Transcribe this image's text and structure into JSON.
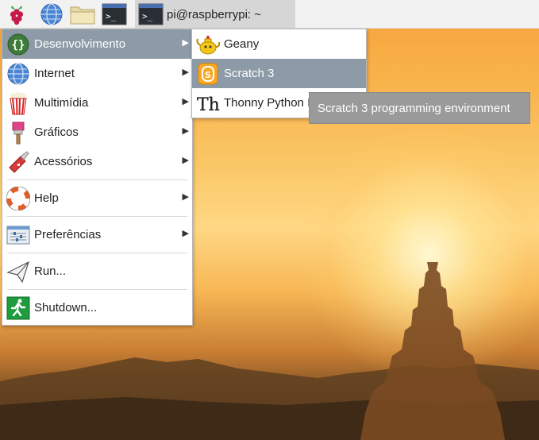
{
  "taskbar": {
    "raspberry_menu_icon": "raspberry-logo",
    "browser_icon": "globe",
    "files_icon": "folder",
    "terminal_icon": "terminal",
    "task": {
      "icon": "terminal",
      "label": "pi@raspberrypi: ~"
    }
  },
  "main_menu": {
    "items": [
      {
        "label": "Desenvolvimento",
        "icon": "code-braces",
        "has_submenu": true,
        "active": true
      },
      {
        "label": "Internet",
        "icon": "globe",
        "has_submenu": true
      },
      {
        "label": "Multimídia",
        "icon": "popcorn",
        "has_submenu": true
      },
      {
        "label": "Gráficos",
        "icon": "paintbrush",
        "has_submenu": true
      },
      {
        "label": "Acessórios",
        "icon": "swiss-knife",
        "has_submenu": true
      },
      {
        "label": "Help",
        "icon": "lifebuoy",
        "has_submenu": true
      },
      {
        "label": "Preferências",
        "icon": "settings-panel",
        "has_submenu": true
      },
      {
        "label": "Run...",
        "icon": "paper-plane",
        "has_submenu": false
      },
      {
        "label": "Shutdown...",
        "icon": "exit-running-man",
        "has_submenu": false
      }
    ]
  },
  "submenu": {
    "items": [
      {
        "label": "Geany",
        "icon": "geany-teapot"
      },
      {
        "label": "Scratch 3",
        "icon": "scratch",
        "active": true
      },
      {
        "label": "Thonny Python IDE",
        "icon": "thonny"
      }
    ]
  },
  "tooltip": {
    "text": "Scratch 3 programming environment"
  },
  "colors": {
    "menu_highlight": "#8c9ba7",
    "tooltip_bg": "#9a9a9a",
    "taskbar_bg": "#f2f2f2"
  }
}
